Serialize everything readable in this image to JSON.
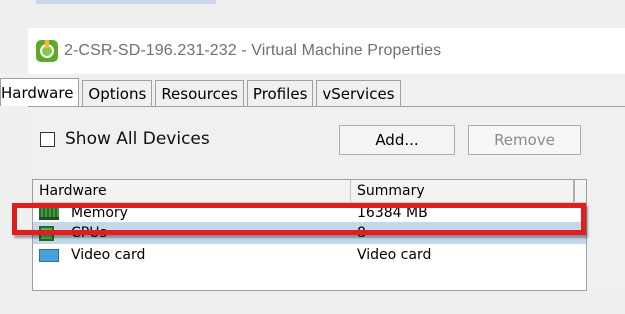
{
  "window": {
    "title": "2-CSR-SD-196.231-232 - Virtual Machine Properties",
    "app_icon": "vm-properties-icon"
  },
  "tabs": [
    {
      "label": "Hardware",
      "active": true
    },
    {
      "label": "Options",
      "active": false
    },
    {
      "label": "Resources",
      "active": false
    },
    {
      "label": "Profiles",
      "active": false
    },
    {
      "label": "vServices",
      "active": false
    }
  ],
  "toolbar": {
    "show_all_devices_label": "Show All Devices",
    "show_all_devices_checked": false,
    "add_label": "Add...",
    "remove_label": "Remove"
  },
  "grid": {
    "columns": [
      "Hardware",
      "Summary"
    ],
    "rows": [
      {
        "name": "Memory",
        "summary": "16384 MB",
        "icon": "memory-icon"
      },
      {
        "name": "CPUs",
        "summary": "8",
        "icon": "cpu-icon",
        "selected": true
      },
      {
        "name": "Video card",
        "summary": "Video card",
        "icon": "video-card-icon"
      }
    ]
  },
  "colors": {
    "highlight": "#e11d1d",
    "selected_row": "#c5d8ea"
  }
}
